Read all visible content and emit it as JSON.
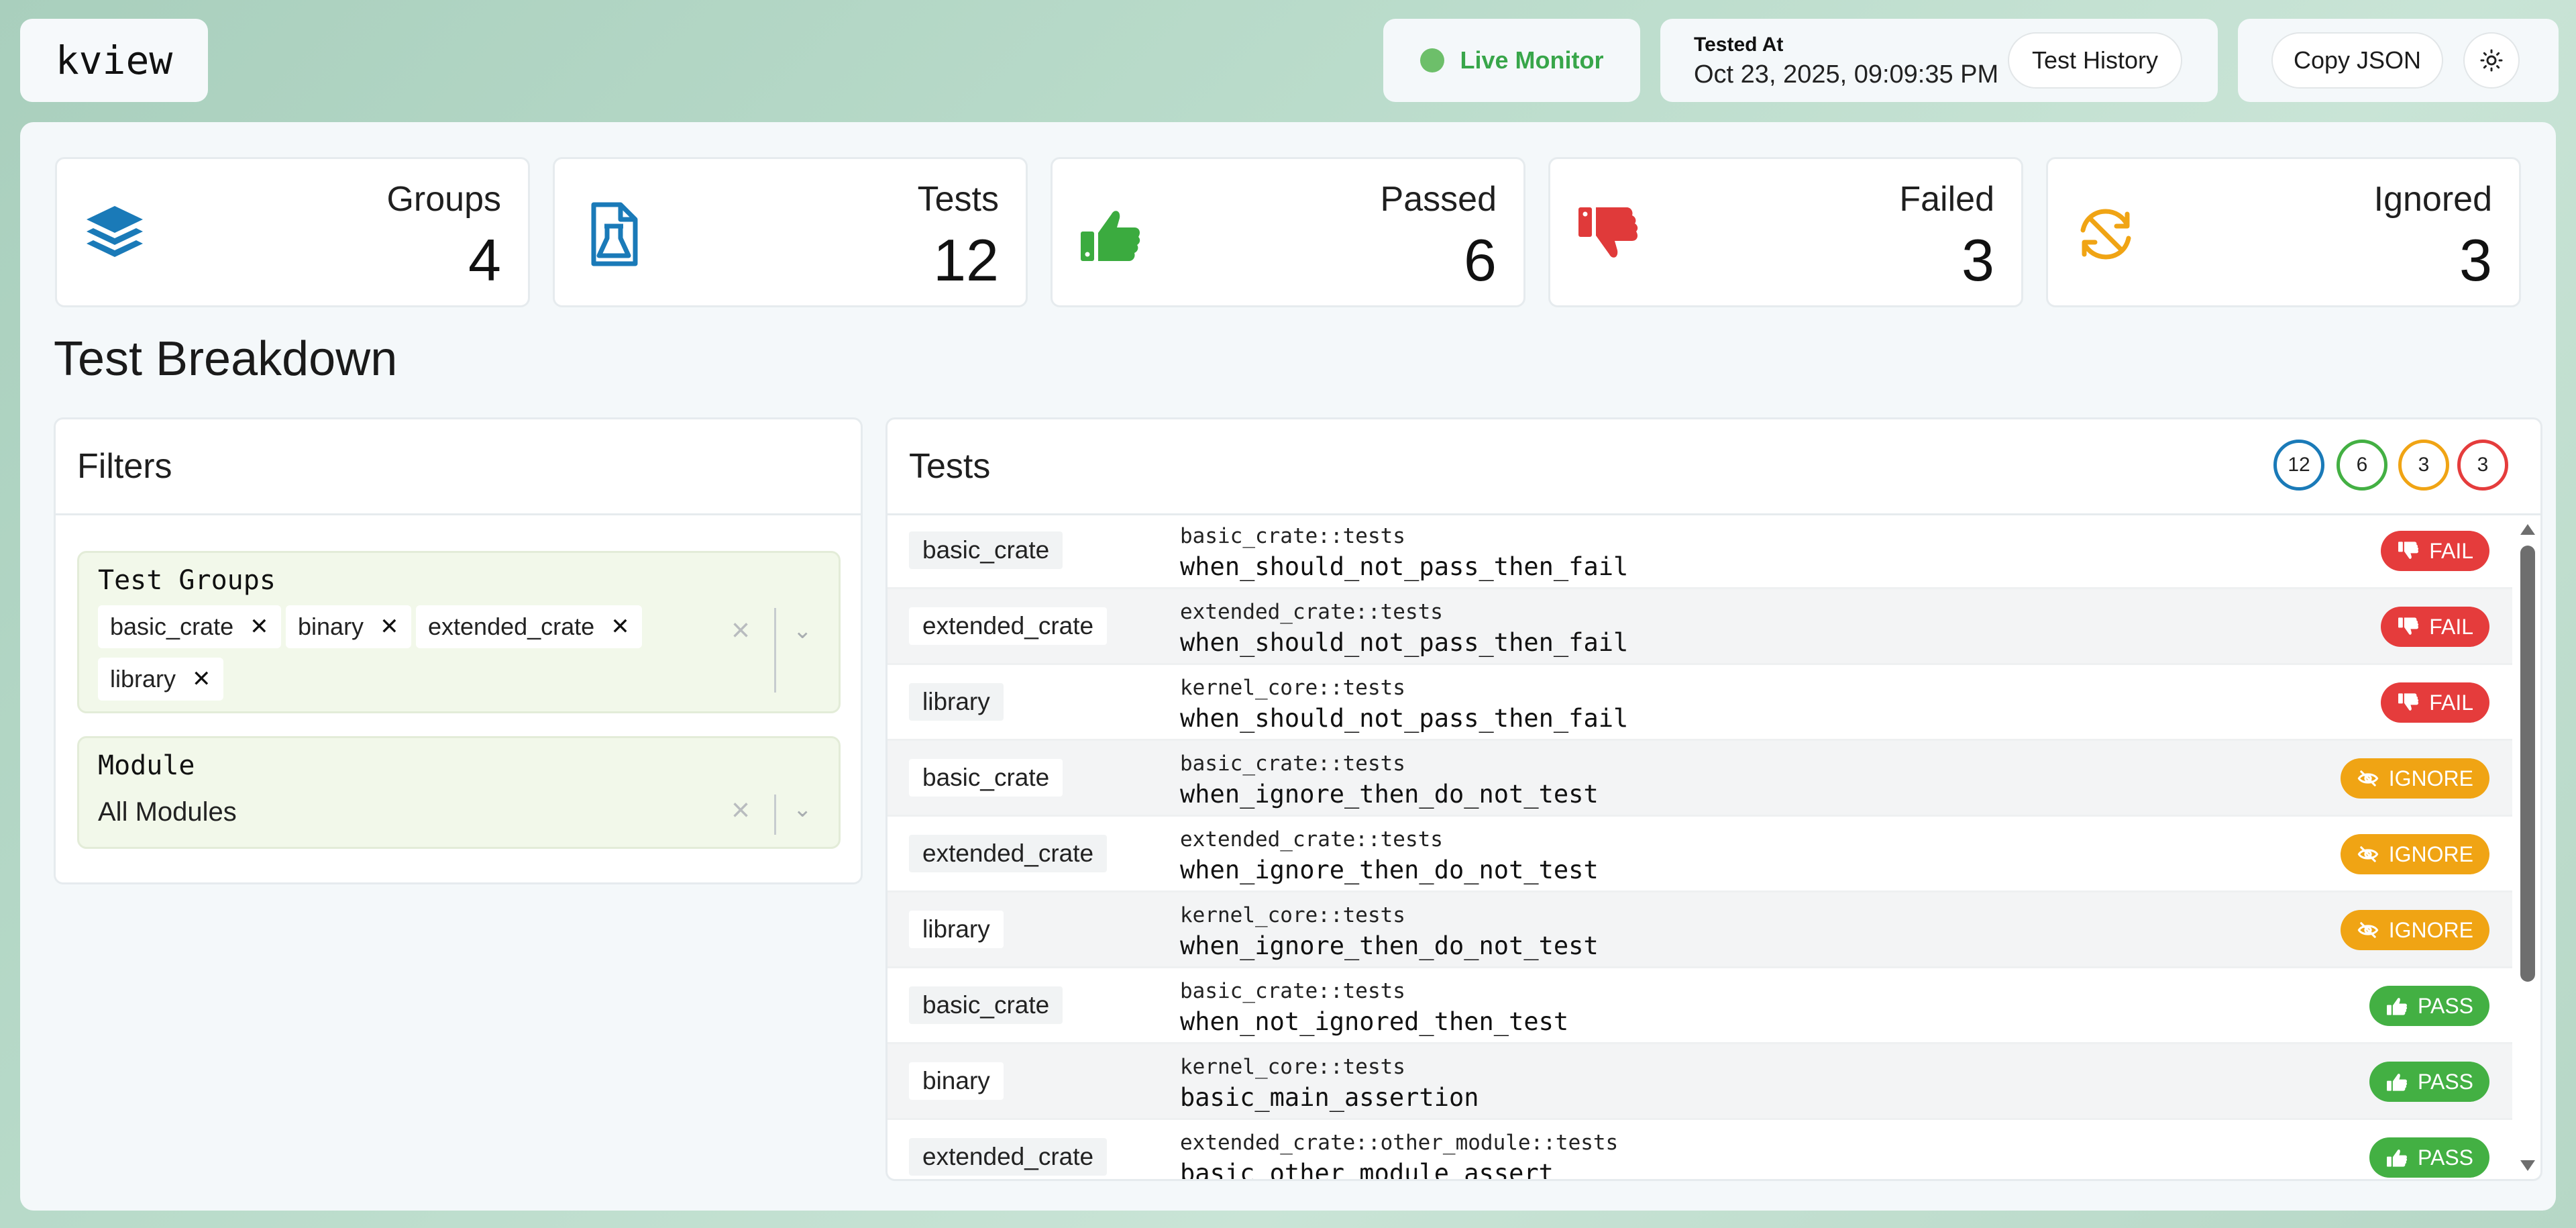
{
  "app": {
    "name": "kview"
  },
  "header": {
    "live_monitor_label": "Live Monitor",
    "tested_at_caption": "Tested At",
    "tested_at_value": "Oct 23, 2025, 09:09:35 PM",
    "test_history_label": "Test History",
    "copy_json_label": "Copy JSON",
    "theme_icon": "sun-icon"
  },
  "stats": [
    {
      "label": "Groups",
      "value": "4",
      "icon": "layers-icon",
      "color": "#1a7ab8"
    },
    {
      "label": "Tests",
      "value": "12",
      "icon": "flask-file-icon",
      "color": "#1a7ab8"
    },
    {
      "label": "Passed",
      "value": "6",
      "icon": "thumbs-up-icon",
      "color": "#3bab3f"
    },
    {
      "label": "Failed",
      "value": "3",
      "icon": "thumbs-down-icon",
      "color": "#e03a3a"
    },
    {
      "label": "Ignored",
      "value": "3",
      "icon": "eye-off-sync-icon",
      "color": "#f0a414"
    }
  ],
  "section_title": "Test Breakdown",
  "filters": {
    "title": "Filters",
    "groups_label": "Test Groups",
    "selected_groups": [
      "basic_crate",
      "binary",
      "extended_crate",
      "library"
    ],
    "module_label": "Module",
    "module_value": "All Modules"
  },
  "tests": {
    "title": "Tests",
    "counts": {
      "total": "12",
      "passed": "6",
      "ignored": "3",
      "failed": "3"
    },
    "rows": [
      {
        "group": "basic_crate",
        "module": "basic_crate::tests",
        "name": "when_should_not_pass_then_fail",
        "status": "FAIL"
      },
      {
        "group": "extended_crate",
        "module": "extended_crate::tests",
        "name": "when_should_not_pass_then_fail",
        "status": "FAIL"
      },
      {
        "group": "library",
        "module": "kernel_core::tests",
        "name": "when_should_not_pass_then_fail",
        "status": "FAIL"
      },
      {
        "group": "basic_crate",
        "module": "basic_crate::tests",
        "name": "when_ignore_then_do_not_test",
        "status": "IGNORE"
      },
      {
        "group": "extended_crate",
        "module": "extended_crate::tests",
        "name": "when_ignore_then_do_not_test",
        "status": "IGNORE"
      },
      {
        "group": "library",
        "module": "kernel_core::tests",
        "name": "when_ignore_then_do_not_test",
        "status": "IGNORE"
      },
      {
        "group": "basic_crate",
        "module": "basic_crate::tests",
        "name": "when_not_ignored_then_test",
        "status": "PASS"
      },
      {
        "group": "binary",
        "module": "kernel_core::tests",
        "name": "basic_main_assertion",
        "status": "PASS"
      },
      {
        "group": "extended_crate",
        "module": "extended_crate::other_module::tests",
        "name": "basic_other_module_assert",
        "status": "PASS"
      }
    ]
  },
  "colors": {
    "fail": "#e53c3c",
    "ignore": "#f0a414",
    "pass": "#43b043",
    "total_ring": "#1a7ab8",
    "pass_ring": "#43b043",
    "ignore_ring": "#f0a414",
    "fail_ring": "#e53c3c",
    "live_dot": "#6dbf6a"
  }
}
